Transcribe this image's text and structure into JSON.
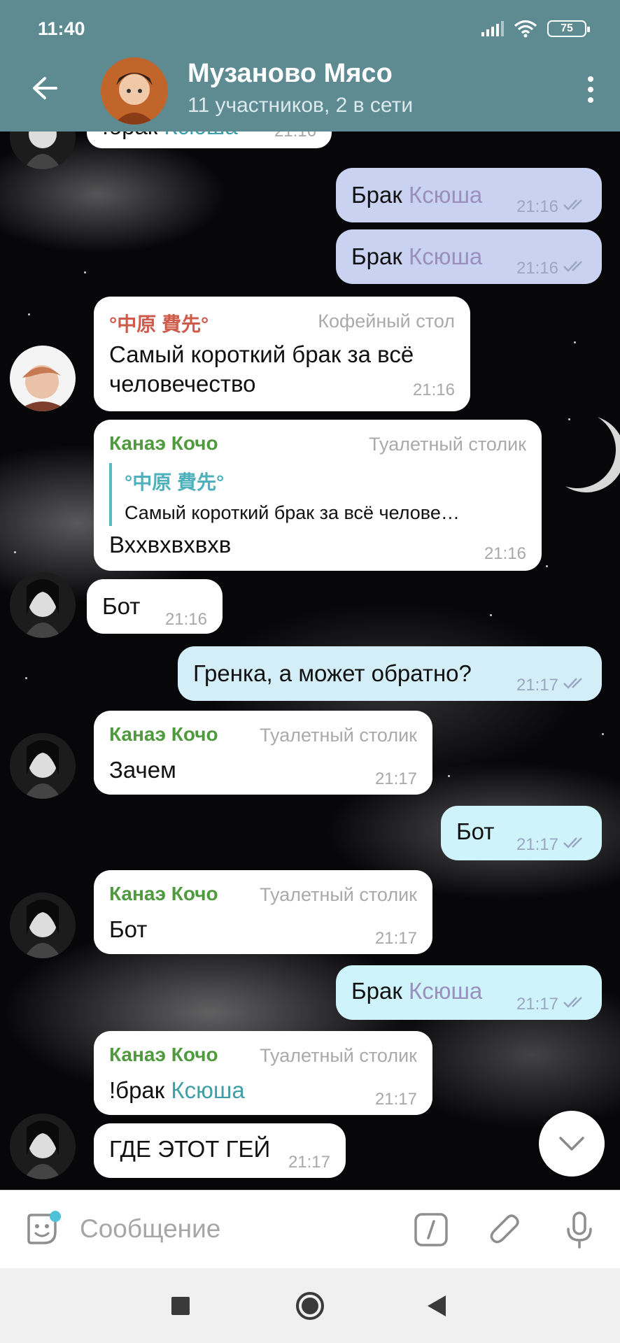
{
  "status": {
    "time": "11:40",
    "battery": "75"
  },
  "header": {
    "title": "Музаново Мясо",
    "subtitle": "11 участников, 2 в сети"
  },
  "messages": [
    {
      "text_prefix": "!брак ",
      "text_name": "Ксюша",
      "time": "21:16"
    },
    {
      "text_prefix": "Брак ",
      "text_name": "Ксюша",
      "time": "21:16"
    },
    {
      "text_prefix": "Брак ",
      "text_name": "Ксюша",
      "time": "21:16"
    },
    {
      "sender": "°中原 費先°",
      "tag": "Кофейный стол",
      "line1": "Самый короткий брак за всё",
      "line2": "человечество",
      "time": "21:16"
    },
    {
      "sender": "Канаэ Кочо",
      "tag": "Туалетный столик",
      "reply_name": "°中原 費先°",
      "reply_text": "Самый короткий брак за всё челове…",
      "text": "Вххвхвхвхв",
      "time": "21:16"
    },
    {
      "text": "Бот",
      "time": "21:16"
    },
    {
      "text": "Гренка, а может обратно?",
      "time": "21:17"
    },
    {
      "sender": "Канаэ Кочо",
      "tag": "Туалетный столик",
      "text": "Зачем",
      "time": "21:17"
    },
    {
      "text": "Бот",
      "time": "21:17"
    },
    {
      "sender": "Канаэ Кочо",
      "tag": "Туалетный столик",
      "text": "Бот",
      "time": "21:17"
    },
    {
      "text_prefix": "Брак ",
      "text_name": "Ксюша",
      "time": "21:17"
    },
    {
      "sender": "Канаэ Кочо",
      "tag": "Туалетный столик",
      "text_prefix": "!брак ",
      "text_name": "Ксюша",
      "time": "21:17"
    },
    {
      "text": "ГДЕ ЭТОТ ГЕЙ",
      "time": "21:17"
    }
  ],
  "input": {
    "placeholder": "Сообщение"
  },
  "colors": {
    "header": "#5e8b92",
    "sender": "#4f9a3e",
    "sender_alt": "#cf5b4b",
    "outgoing": "#c9d2f0"
  }
}
